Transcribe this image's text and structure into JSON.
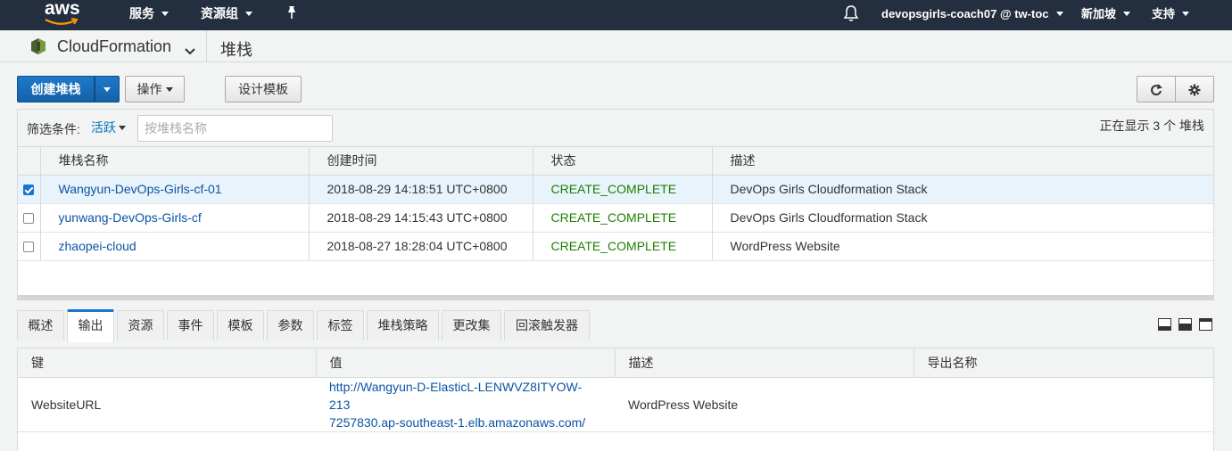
{
  "topnav": {
    "logo_text": "aws",
    "services_label": "服务",
    "resource_groups_label": "资源组",
    "account_label": "devopsgirls-coach07 @ tw-toc",
    "region_label": "新加坡",
    "support_label": "支持"
  },
  "service_bar": {
    "service_name": "CloudFormation",
    "breadcrumb": "堆栈"
  },
  "toolbar": {
    "create_stack_label": "创建堆栈",
    "actions_label": "操作",
    "design_template_label": "设计模板"
  },
  "filter": {
    "label": "筛选条件:",
    "active_label": "活跃",
    "search_placeholder": "按堆栈名称",
    "count_text": "正在显示 3 个 堆栈"
  },
  "stacks_table": {
    "headers": [
      "堆栈名称",
      "创建时间",
      "状态",
      "描述"
    ],
    "rows": [
      {
        "name": "Wangyun-DevOps-Girls-cf-01",
        "created": "2018-08-29 14:18:51 UTC+0800",
        "status": "CREATE_COMPLETE",
        "description": "DevOps Girls Cloudformation Stack",
        "selected": true
      },
      {
        "name": "yunwang-DevOps-Girls-cf",
        "created": "2018-08-29 14:15:43 UTC+0800",
        "status": "CREATE_COMPLETE",
        "description": "DevOps Girls Cloudformation Stack",
        "selected": false
      },
      {
        "name": "zhaopei-cloud",
        "created": "2018-08-27 18:28:04 UTC+0800",
        "status": "CREATE_COMPLETE",
        "description": "WordPress Website",
        "selected": false
      }
    ]
  },
  "detail_tabs": {
    "items": [
      "概述",
      "输出",
      "资源",
      "事件",
      "模板",
      "参数",
      "标签",
      "堆栈策略",
      "更改集",
      "回滚触发器"
    ],
    "active": "输出"
  },
  "outputs_table": {
    "headers": [
      "键",
      "值",
      "描述",
      "导出名称"
    ],
    "rows": [
      {
        "key": "WebsiteURL",
        "value_line1": "http://Wangyun-D-ElasticL-LENWVZ8ITYOW-213",
        "value_line2": "7257830.ap-southeast-1.elb.amazonaws.com/",
        "description": "WordPress Website",
        "export_name": ""
      }
    ]
  },
  "colors": {
    "nav_bg": "#232f3e",
    "primary": "#1a73d0",
    "link": "#0b54a3",
    "success": "#1d8102"
  }
}
